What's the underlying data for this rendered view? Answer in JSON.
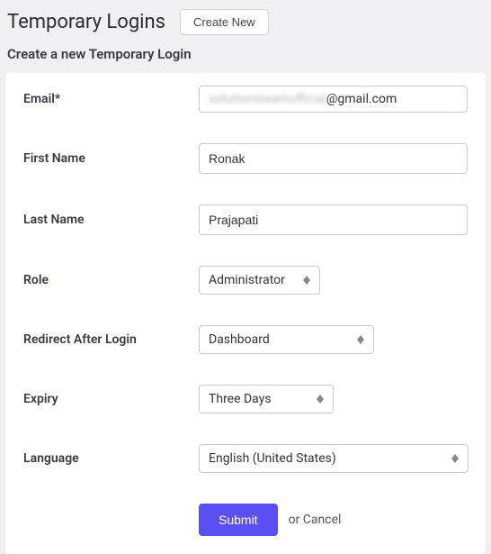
{
  "header": {
    "title": "Temporary Logins",
    "create_new": "Create New"
  },
  "subheading": "Create a new Temporary Login",
  "form": {
    "email": {
      "label": "Email*",
      "value_prefix": "solutionsteamofficial",
      "value_suffix": "@gmail.com"
    },
    "first_name": {
      "label": "First Name",
      "value": "Ronak"
    },
    "last_name": {
      "label": "Last Name",
      "value": "Prajapati"
    },
    "role": {
      "label": "Role",
      "value": "Administrator"
    },
    "redirect": {
      "label": "Redirect After Login",
      "value": "Dashboard"
    },
    "expiry": {
      "label": "Expiry",
      "value": "Three Days"
    },
    "language": {
      "label": "Language",
      "value": "English (United States)"
    }
  },
  "actions": {
    "submit": "Submit",
    "or": "or",
    "cancel": "Cancel"
  }
}
